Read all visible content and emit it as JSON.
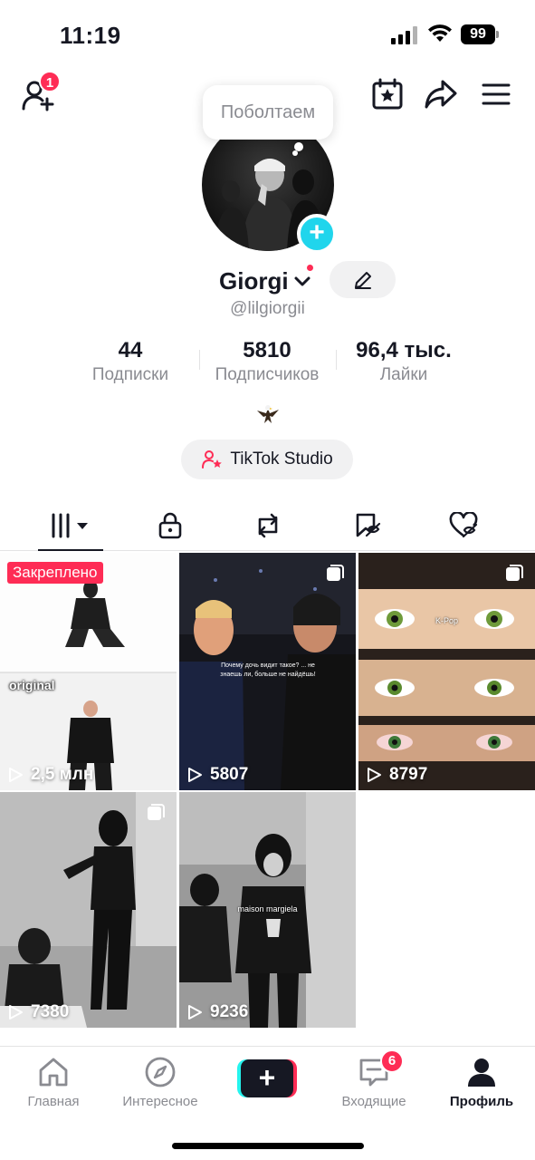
{
  "status_bar": {
    "time": "11:19",
    "battery": "99"
  },
  "header": {
    "notification_count": "1",
    "tooltip": "Поболтаем"
  },
  "profile": {
    "name": "Giorgi",
    "username": "@lilgiorgii",
    "bio_emoji": "🦅",
    "studio_button": "TikTok Studio"
  },
  "stats": [
    {
      "value": "44",
      "label": "Подписки"
    },
    {
      "value": "5810",
      "label": "Подписчиков"
    },
    {
      "value": "96,4 тыс.",
      "label": "Лайки"
    }
  ],
  "tabs": [
    "videos-grid-icon",
    "lock-icon",
    "repost-icon",
    "favorites-icon",
    "liked-icon"
  ],
  "videos": [
    {
      "views": "2,5 млн",
      "pinned_label": "Закреплено",
      "overlay_text": "original"
    },
    {
      "views": "5807",
      "overlay_text": "Почему дочь видит такое? ... не знаешь ли, больше не найдёшь!"
    },
    {
      "views": "8797",
      "overlay_text": "K-Pop"
    },
    {
      "views": "7380"
    },
    {
      "views": "9236",
      "overlay_text": "maison margiela"
    }
  ],
  "bottom_nav": {
    "items": [
      {
        "label": "Главная"
      },
      {
        "label": "Интересное"
      },
      {
        "label": "Входящие"
      },
      {
        "label": "Профиль"
      }
    ],
    "inbox_badge": "6"
  },
  "colors": {
    "accent": "#fe2c55",
    "avatar_add": "#20d5ec",
    "text_secondary": "#8a8b91"
  }
}
